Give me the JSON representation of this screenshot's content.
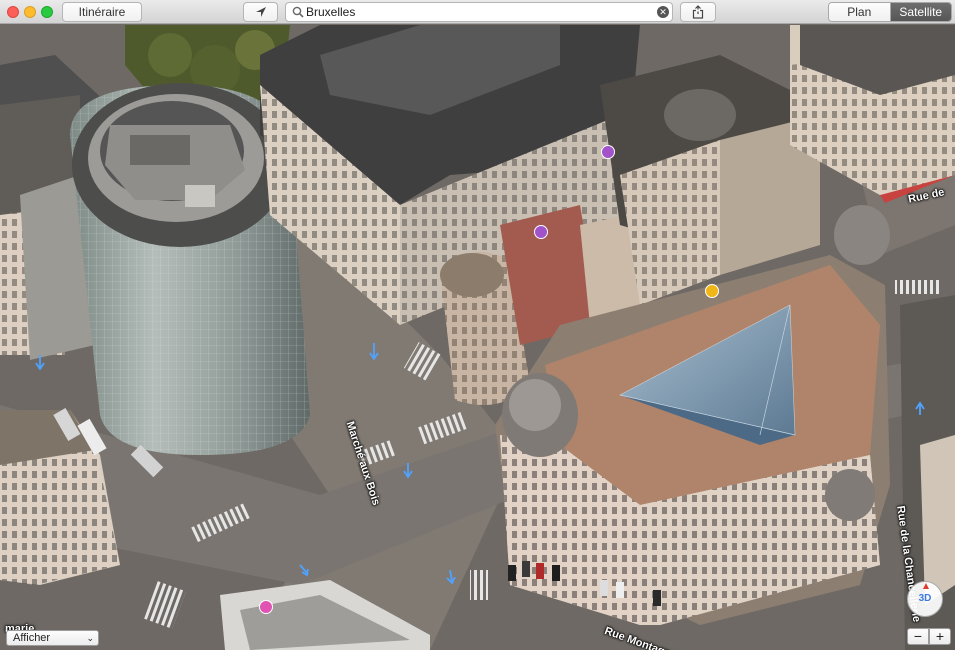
{
  "toolbar": {
    "itinerary_label": "Itinéraire",
    "search_value": "Bruxelles",
    "view_modes": {
      "plan": "Plan",
      "satellite": "Satellite",
      "selected": "Satellite"
    }
  },
  "map": {
    "street_labels": {
      "marche_aux_bois": "Marché aux Bois",
      "rue_de": "Rue de",
      "rue_chancellerie": "Rue de la Chancellerie",
      "rue_montage": "Rue Montage du Parc",
      "marie": "marie"
    },
    "poi_pins": [
      {
        "icon": "theater-icon",
        "color": "#a253c9"
      },
      {
        "icon": "theater-icon",
        "color": "#a253c9"
      },
      {
        "icon": "shopping-icon",
        "color": "#f0b617"
      },
      {
        "icon": "bar-icon",
        "color": "#e053b2"
      }
    ]
  },
  "controls": {
    "show_menu_value": "Afficher",
    "compass_label": "3D",
    "zoom_out": "−",
    "zoom_in": "+"
  }
}
